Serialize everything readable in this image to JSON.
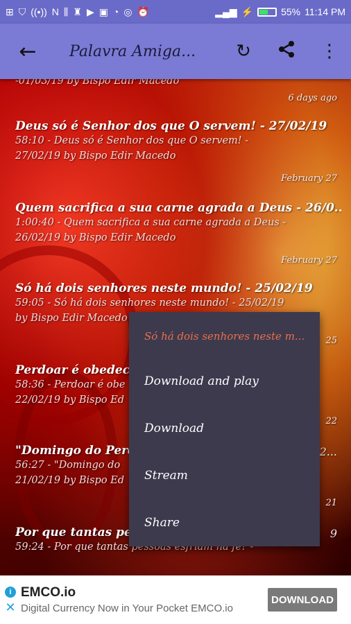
{
  "status_bar": {
    "battery": "55%",
    "time": "11:14 PM",
    "battery_level": 0.55
  },
  "toolbar": {
    "title": "Palavra Amiga..."
  },
  "list": {
    "top_partial_text": "-01/03/19 by Bispo Edir Macedo",
    "top_partial_date": "6 days ago",
    "items": [
      {
        "title": "Deus só é Senhor dos que O servem! - 27/02/19",
        "desc_line1": "58:10 - Deus só é Senhor dos que O servem! -",
        "desc_line2": "27/02/19 by Bispo Edir Macedo",
        "date": "February 27"
      },
      {
        "title": "Quem sacrifica a sua carne agrada a Deus - 26/0...",
        "desc_line1": "1:00:40 - Quem sacrifica a sua carne agrada a Deus -",
        "desc_line2": "26/02/19 by Bispo Edir Macedo",
        "date": "February 27"
      },
      {
        "title": "Só há dois senhores neste mundo! - 25/02/19",
        "desc_line1": "59:05 - Só há dois senhores neste mundo! - 25/02/19",
        "desc_line2": "by Bispo Edir Macedo",
        "date": "25"
      },
      {
        "title": "Perdoar é obedece",
        "desc_line1": "58:36 - Perdoar é obe",
        "desc_line2": "22/02/19 by Bispo Ed",
        "date": "22"
      },
      {
        "title": "\"Domingo do Perdã",
        "title_tail": "2...",
        "desc_line1": "56:27 - \"Domingo do",
        "desc_line2": "21/02/19 by Bispo Ed",
        "date": "21"
      },
      {
        "title": "Por que tantas pes",
        "title_tail": "9",
        "desc_line1": "59:24 - Por que tantas pessoas esfriam na fé? -",
        "desc_line2": "",
        "date": ""
      }
    ]
  },
  "context_menu": {
    "header": "Só há dois senhores neste m...",
    "items": [
      "Download and play",
      "Download",
      "Stream",
      "Share"
    ]
  },
  "ad": {
    "title": "EMCO.io",
    "subtitle": "Digital Currency Now in Your Pocket EMCO.io",
    "button": "DOWNLOAD"
  },
  "colors": {
    "statusbar": "#6a6ac8",
    "toolbar": "#7b7bd6",
    "menu_bg": "#3d3a4e",
    "menu_header": "#e8704a"
  }
}
